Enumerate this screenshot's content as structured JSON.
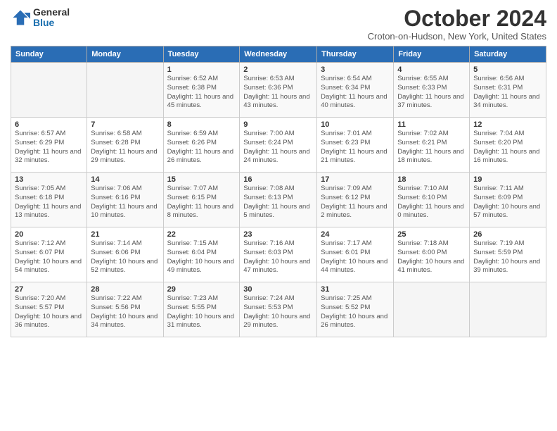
{
  "logo": {
    "general": "General",
    "blue": "Blue"
  },
  "title": "October 2024",
  "subtitle": "Croton-on-Hudson, New York, United States",
  "headers": [
    "Sunday",
    "Monday",
    "Tuesday",
    "Wednesday",
    "Thursday",
    "Friday",
    "Saturday"
  ],
  "weeks": [
    [
      {
        "day": "",
        "sunrise": "",
        "sunset": "",
        "daylight": ""
      },
      {
        "day": "",
        "sunrise": "",
        "sunset": "",
        "daylight": ""
      },
      {
        "day": "1",
        "sunrise": "Sunrise: 6:52 AM",
        "sunset": "Sunset: 6:38 PM",
        "daylight": "Daylight: 11 hours and 45 minutes."
      },
      {
        "day": "2",
        "sunrise": "Sunrise: 6:53 AM",
        "sunset": "Sunset: 6:36 PM",
        "daylight": "Daylight: 11 hours and 43 minutes."
      },
      {
        "day": "3",
        "sunrise": "Sunrise: 6:54 AM",
        "sunset": "Sunset: 6:34 PM",
        "daylight": "Daylight: 11 hours and 40 minutes."
      },
      {
        "day": "4",
        "sunrise": "Sunrise: 6:55 AM",
        "sunset": "Sunset: 6:33 PM",
        "daylight": "Daylight: 11 hours and 37 minutes."
      },
      {
        "day": "5",
        "sunrise": "Sunrise: 6:56 AM",
        "sunset": "Sunset: 6:31 PM",
        "daylight": "Daylight: 11 hours and 34 minutes."
      }
    ],
    [
      {
        "day": "6",
        "sunrise": "Sunrise: 6:57 AM",
        "sunset": "Sunset: 6:29 PM",
        "daylight": "Daylight: 11 hours and 32 minutes."
      },
      {
        "day": "7",
        "sunrise": "Sunrise: 6:58 AM",
        "sunset": "Sunset: 6:28 PM",
        "daylight": "Daylight: 11 hours and 29 minutes."
      },
      {
        "day": "8",
        "sunrise": "Sunrise: 6:59 AM",
        "sunset": "Sunset: 6:26 PM",
        "daylight": "Daylight: 11 hours and 26 minutes."
      },
      {
        "day": "9",
        "sunrise": "Sunrise: 7:00 AM",
        "sunset": "Sunset: 6:24 PM",
        "daylight": "Daylight: 11 hours and 24 minutes."
      },
      {
        "day": "10",
        "sunrise": "Sunrise: 7:01 AM",
        "sunset": "Sunset: 6:23 PM",
        "daylight": "Daylight: 11 hours and 21 minutes."
      },
      {
        "day": "11",
        "sunrise": "Sunrise: 7:02 AM",
        "sunset": "Sunset: 6:21 PM",
        "daylight": "Daylight: 11 hours and 18 minutes."
      },
      {
        "day": "12",
        "sunrise": "Sunrise: 7:04 AM",
        "sunset": "Sunset: 6:20 PM",
        "daylight": "Daylight: 11 hours and 16 minutes."
      }
    ],
    [
      {
        "day": "13",
        "sunrise": "Sunrise: 7:05 AM",
        "sunset": "Sunset: 6:18 PM",
        "daylight": "Daylight: 11 hours and 13 minutes."
      },
      {
        "day": "14",
        "sunrise": "Sunrise: 7:06 AM",
        "sunset": "Sunset: 6:16 PM",
        "daylight": "Daylight: 11 hours and 10 minutes."
      },
      {
        "day": "15",
        "sunrise": "Sunrise: 7:07 AM",
        "sunset": "Sunset: 6:15 PM",
        "daylight": "Daylight: 11 hours and 8 minutes."
      },
      {
        "day": "16",
        "sunrise": "Sunrise: 7:08 AM",
        "sunset": "Sunset: 6:13 PM",
        "daylight": "Daylight: 11 hours and 5 minutes."
      },
      {
        "day": "17",
        "sunrise": "Sunrise: 7:09 AM",
        "sunset": "Sunset: 6:12 PM",
        "daylight": "Daylight: 11 hours and 2 minutes."
      },
      {
        "day": "18",
        "sunrise": "Sunrise: 7:10 AM",
        "sunset": "Sunset: 6:10 PM",
        "daylight": "Daylight: 11 hours and 0 minutes."
      },
      {
        "day": "19",
        "sunrise": "Sunrise: 7:11 AM",
        "sunset": "Sunset: 6:09 PM",
        "daylight": "Daylight: 10 hours and 57 minutes."
      }
    ],
    [
      {
        "day": "20",
        "sunrise": "Sunrise: 7:12 AM",
        "sunset": "Sunset: 6:07 PM",
        "daylight": "Daylight: 10 hours and 54 minutes."
      },
      {
        "day": "21",
        "sunrise": "Sunrise: 7:14 AM",
        "sunset": "Sunset: 6:06 PM",
        "daylight": "Daylight: 10 hours and 52 minutes."
      },
      {
        "day": "22",
        "sunrise": "Sunrise: 7:15 AM",
        "sunset": "Sunset: 6:04 PM",
        "daylight": "Daylight: 10 hours and 49 minutes."
      },
      {
        "day": "23",
        "sunrise": "Sunrise: 7:16 AM",
        "sunset": "Sunset: 6:03 PM",
        "daylight": "Daylight: 10 hours and 47 minutes."
      },
      {
        "day": "24",
        "sunrise": "Sunrise: 7:17 AM",
        "sunset": "Sunset: 6:01 PM",
        "daylight": "Daylight: 10 hours and 44 minutes."
      },
      {
        "day": "25",
        "sunrise": "Sunrise: 7:18 AM",
        "sunset": "Sunset: 6:00 PM",
        "daylight": "Daylight: 10 hours and 41 minutes."
      },
      {
        "day": "26",
        "sunrise": "Sunrise: 7:19 AM",
        "sunset": "Sunset: 5:59 PM",
        "daylight": "Daylight: 10 hours and 39 minutes."
      }
    ],
    [
      {
        "day": "27",
        "sunrise": "Sunrise: 7:20 AM",
        "sunset": "Sunset: 5:57 PM",
        "daylight": "Daylight: 10 hours and 36 minutes."
      },
      {
        "day": "28",
        "sunrise": "Sunrise: 7:22 AM",
        "sunset": "Sunset: 5:56 PM",
        "daylight": "Daylight: 10 hours and 34 minutes."
      },
      {
        "day": "29",
        "sunrise": "Sunrise: 7:23 AM",
        "sunset": "Sunset: 5:55 PM",
        "daylight": "Daylight: 10 hours and 31 minutes."
      },
      {
        "day": "30",
        "sunrise": "Sunrise: 7:24 AM",
        "sunset": "Sunset: 5:53 PM",
        "daylight": "Daylight: 10 hours and 29 minutes."
      },
      {
        "day": "31",
        "sunrise": "Sunrise: 7:25 AM",
        "sunset": "Sunset: 5:52 PM",
        "daylight": "Daylight: 10 hours and 26 minutes."
      },
      {
        "day": "",
        "sunrise": "",
        "sunset": "",
        "daylight": ""
      },
      {
        "day": "",
        "sunrise": "",
        "sunset": "",
        "daylight": ""
      }
    ]
  ]
}
